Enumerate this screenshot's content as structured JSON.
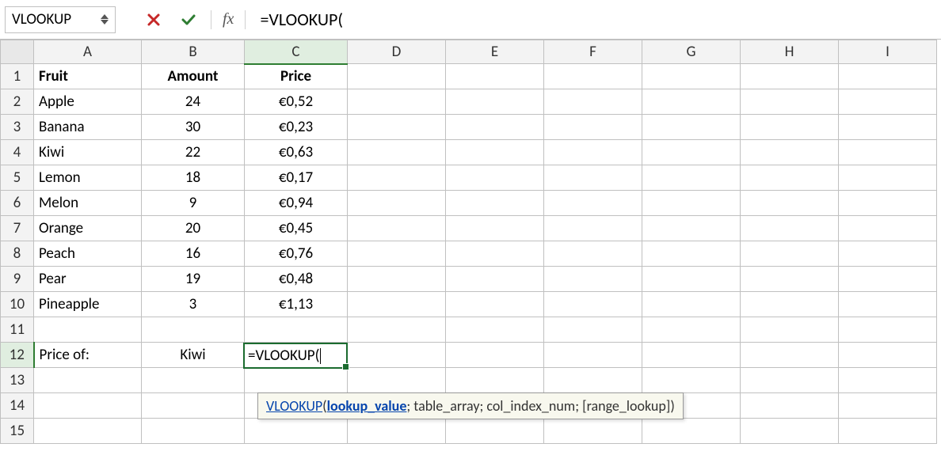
{
  "formula_bar": {
    "name_box": "VLOOKUP",
    "fx_label": "fx",
    "formula": "=VLOOKUP("
  },
  "columns": [
    "A",
    "B",
    "C",
    "D",
    "E",
    "F",
    "G",
    "H",
    "I"
  ],
  "row_numbers": [
    "1",
    "2",
    "3",
    "4",
    "5",
    "6",
    "7",
    "8",
    "9",
    "10",
    "11",
    "12",
    "13",
    "14",
    "15"
  ],
  "headers": {
    "A": "Fruit",
    "B": "Amount",
    "C": "Price"
  },
  "rows": [
    {
      "A": "Apple",
      "B": "24",
      "C": "€0,52"
    },
    {
      "A": "Banana",
      "B": "30",
      "C": "€0,23"
    },
    {
      "A": "Kiwi",
      "B": "22",
      "C": "€0,63"
    },
    {
      "A": "Lemon",
      "B": "18",
      "C": "€0,17"
    },
    {
      "A": "Melon",
      "B": "9",
      "C": "€0,94"
    },
    {
      "A": "Orange",
      "B": "20",
      "C": "€0,45"
    },
    {
      "A": "Peach",
      "B": "16",
      "C": "€0,76"
    },
    {
      "A": "Pear",
      "B": "19",
      "C": "€0,48"
    },
    {
      "A": "Pineapple",
      "B": "3",
      "C": "€1,13"
    }
  ],
  "lookup_row": {
    "A": "Price of:",
    "B": "Kiwi",
    "C": "=VLOOKUP("
  },
  "tooltip": {
    "fn": "VLOOKUP",
    "open": "(",
    "p1": "lookup_value",
    "rest": "; table_array; col_index_num; [range_lookup])"
  }
}
